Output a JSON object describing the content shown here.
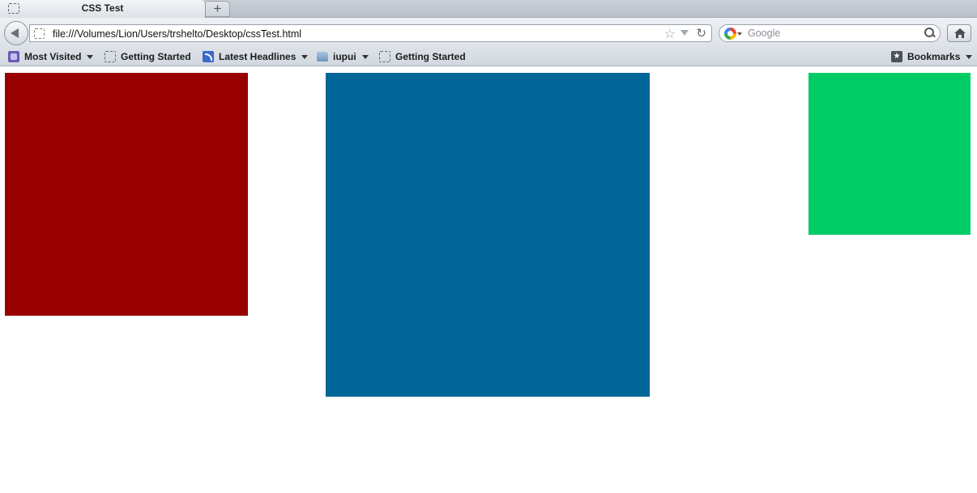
{
  "tab": {
    "title": "CSS Test",
    "new_tab_label": "+"
  },
  "navigation": {
    "url": "file:///Volumes/Lion/Users/trshelto/Desktop/cssTest.html"
  },
  "search": {
    "engine": "Google",
    "placeholder": "Google"
  },
  "bookmarks": {
    "items": [
      {
        "label": "Most Visited",
        "icon": "smart-folder-icon",
        "has_menu": true
      },
      {
        "label": "Getting Started",
        "icon": "page-icon",
        "has_menu": false
      },
      {
        "label": "Latest Headlines",
        "icon": "rss-icon",
        "has_menu": true
      },
      {
        "label": "iupui",
        "icon": "folder-icon",
        "has_menu": true
      },
      {
        "label": "Getting Started",
        "icon": "page-icon",
        "has_menu": false
      }
    ],
    "bookmarks_menu_label": "Bookmarks"
  },
  "page": {
    "boxes": [
      {
        "name": "red-box",
        "color": "#990000"
      },
      {
        "name": "blue-box",
        "color": "#006699"
      },
      {
        "name": "green-box",
        "color": "#00cc66"
      }
    ]
  }
}
